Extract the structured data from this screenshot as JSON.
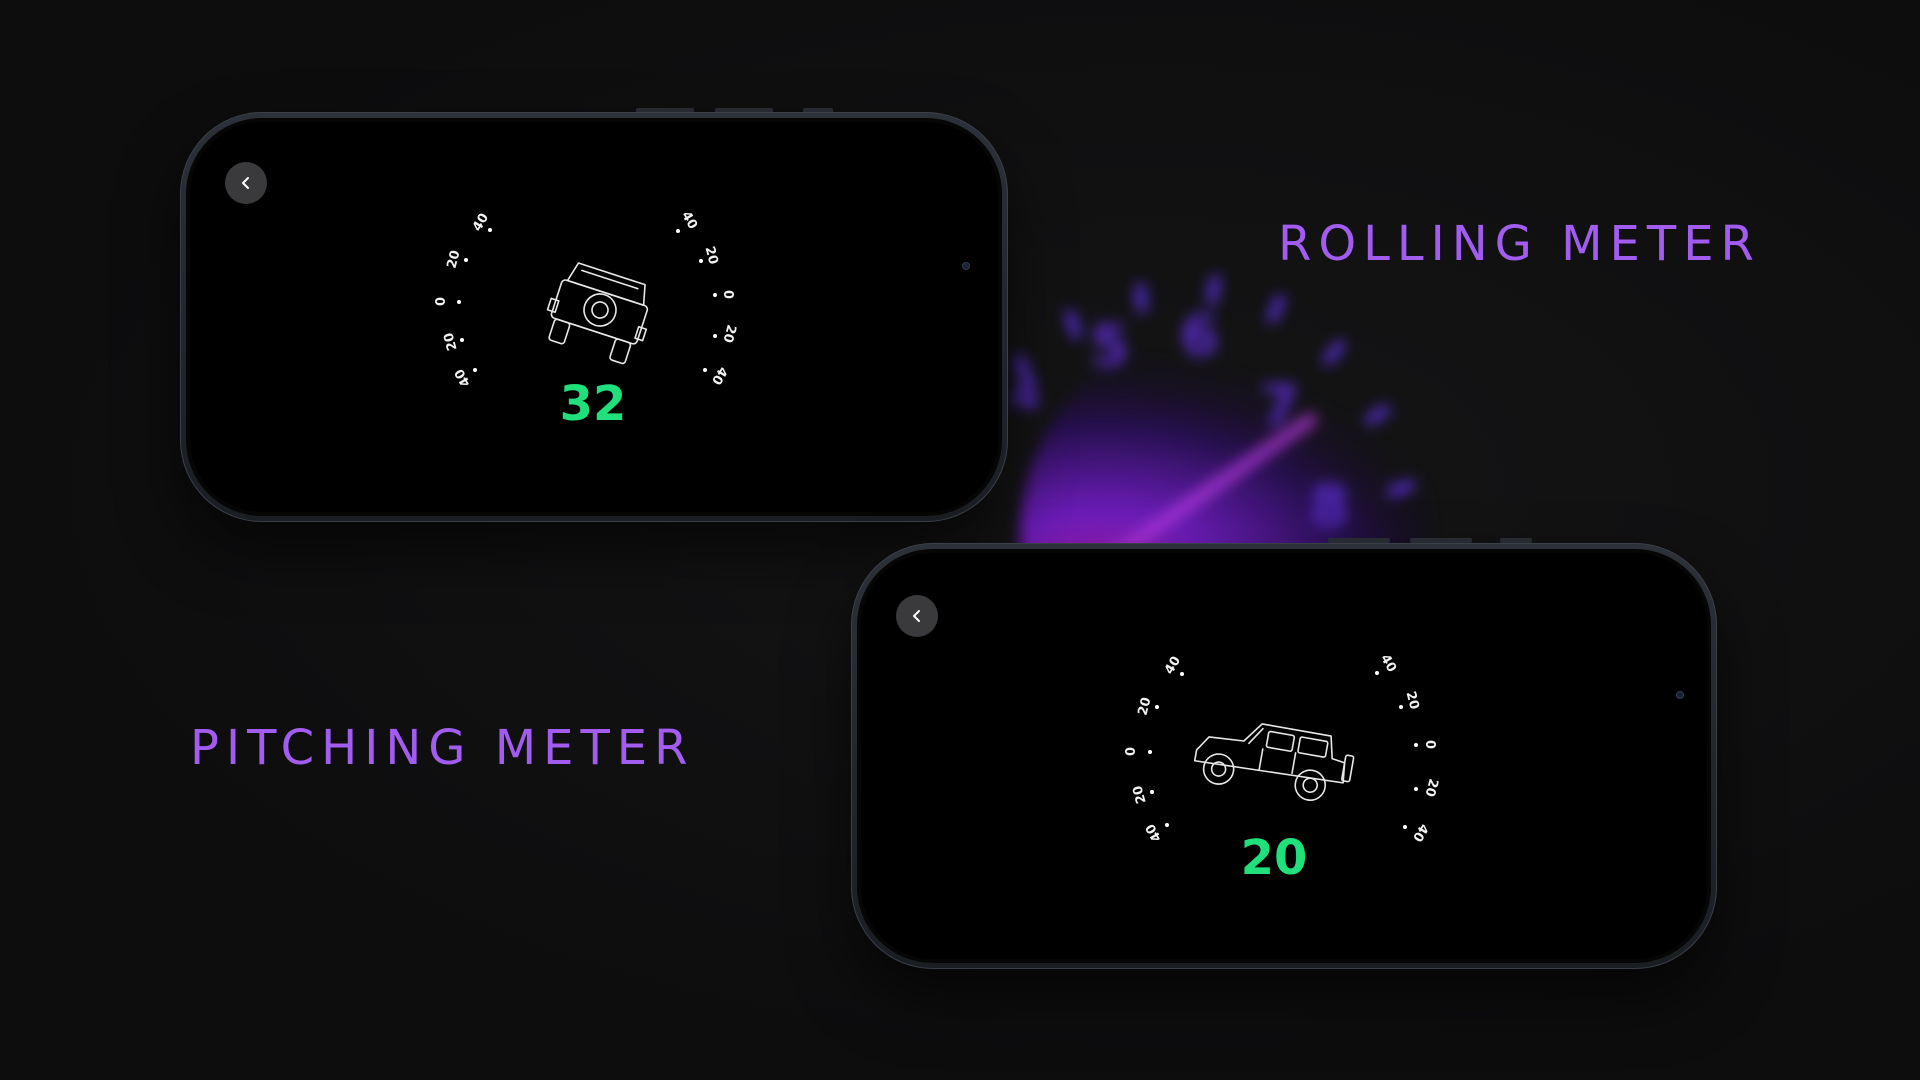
{
  "headlines": {
    "rolling": "ROLLING METER",
    "pitching": "PITCHING METER"
  },
  "colors": {
    "accent_purple": "#a35cf0",
    "reading_green": "#1fe07a",
    "background": "#0e0e0f"
  },
  "rolling_screen": {
    "back_icon": "chevron-left-icon",
    "left_scale": [
      "40",
      "20",
      "0",
      "20",
      "40"
    ],
    "right_scale": [
      "40",
      "20",
      "0",
      "20",
      "40"
    ],
    "vehicle": "jeep-rear-view",
    "reading": "32"
  },
  "pitching_screen": {
    "back_icon": "chevron-left-icon",
    "left_scale": [
      "40",
      "20",
      "0",
      "20",
      "40"
    ],
    "right_scale": [
      "40",
      "20",
      "0",
      "20",
      "40"
    ],
    "vehicle": "jeep-side-view",
    "reading": "20"
  }
}
